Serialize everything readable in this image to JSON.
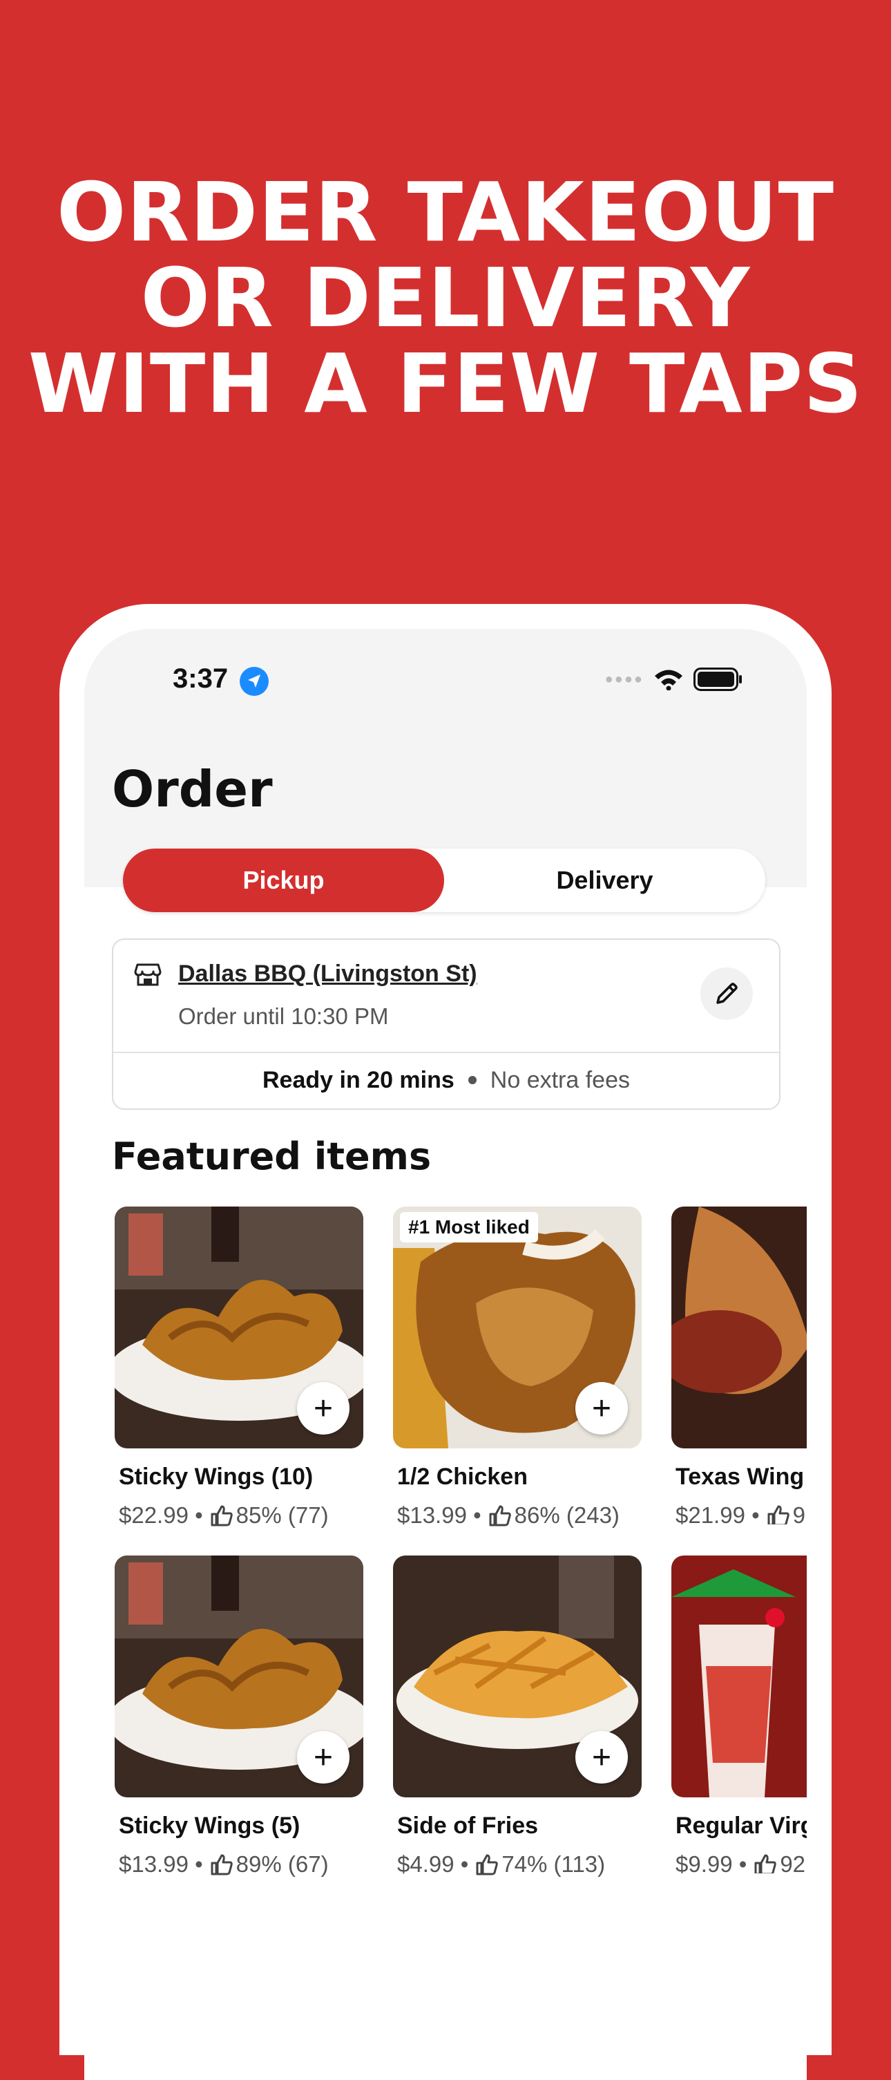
{
  "headline": {
    "line1": "ORDER TAKEOUT",
    "line2": "OR DELIVERY",
    "line3": "WITH A FEW TAPS"
  },
  "status_bar": {
    "time": "3:37"
  },
  "page": {
    "title": "Order"
  },
  "mode_toggle": {
    "pickup": "Pickup",
    "delivery": "Delivery",
    "selected": "Pickup"
  },
  "store": {
    "name": "Dallas BBQ (Livingston St)",
    "hours": "Order until 10:30 PM",
    "ready": "Ready in 20 mins",
    "fees": "No extra fees"
  },
  "featured": {
    "title": "Featured items",
    "items": [
      {
        "name": "Sticky Wings (10)",
        "price": "$22.99",
        "rating": "85% (77)",
        "badge": ""
      },
      {
        "name": "1/2 Chicken",
        "price": "$13.99",
        "rating": "86% (243)",
        "badge": "#1 Most liked"
      },
      {
        "name": "Texas Wing",
        "price": "$21.99",
        "rating": "9",
        "badge": ""
      },
      {
        "name": "Sticky Wings (5)",
        "price": "$13.99",
        "rating": "89% (67)",
        "badge": ""
      },
      {
        "name": "Side of Fries",
        "price": "$4.99",
        "rating": "74% (113)",
        "badge": ""
      },
      {
        "name": "Regular Virg",
        "price": "$9.99",
        "rating": "92",
        "badge": ""
      }
    ]
  },
  "colors": {
    "brand_red": "#d42f2f",
    "location_blue": "#1a8cff"
  }
}
